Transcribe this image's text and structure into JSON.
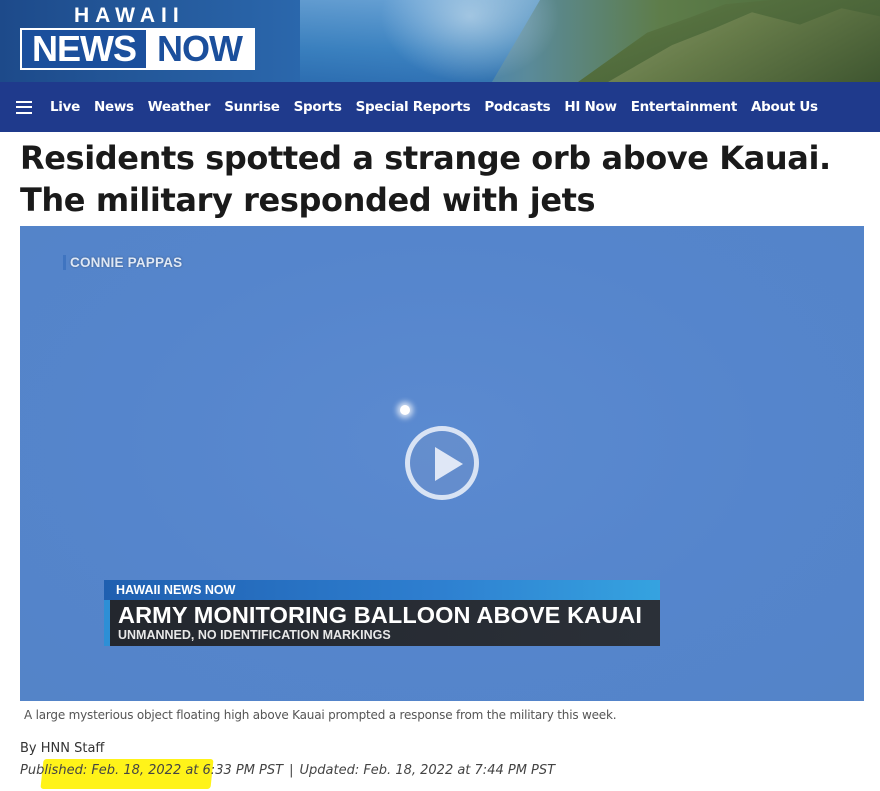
{
  "header": {
    "logo_top": "HAWAII",
    "logo_news": "NEWS",
    "logo_now": "NOW"
  },
  "nav": {
    "menu_icon": "hamburger-icon",
    "items": [
      "Live",
      "News",
      "Weather",
      "Sunrise",
      "Sports",
      "Special Reports",
      "Podcasts",
      "HI Now",
      "Entertainment",
      "About Us"
    ]
  },
  "article": {
    "headline": "Residents spotted a strange orb above Kauai. The military responded with jets",
    "video": {
      "credit": "CONNIE PAPPAS",
      "lower_third_top": "HAWAII NEWS NOW",
      "lower_third_main": "ARMY MONITORING BALLOON ABOVE KAUAI",
      "lower_third_sub": "UNMANNED, NO IDENTIFICATION MARKINGS",
      "play_icon": "play-icon"
    },
    "caption": "A large mysterious object floating high above Kauai prompted a response from the military this week.",
    "byline": "By HNN Staff",
    "published": "Published: Feb. 18, 2022 at 6:33 PM PST",
    "separator": "|",
    "updated": "Updated: Feb. 18, 2022 at 7:44 PM PST"
  },
  "colors": {
    "nav_bg": "#1f3a8c",
    "brand_blue": "#1b4f9c",
    "highlight": "#fff200"
  }
}
